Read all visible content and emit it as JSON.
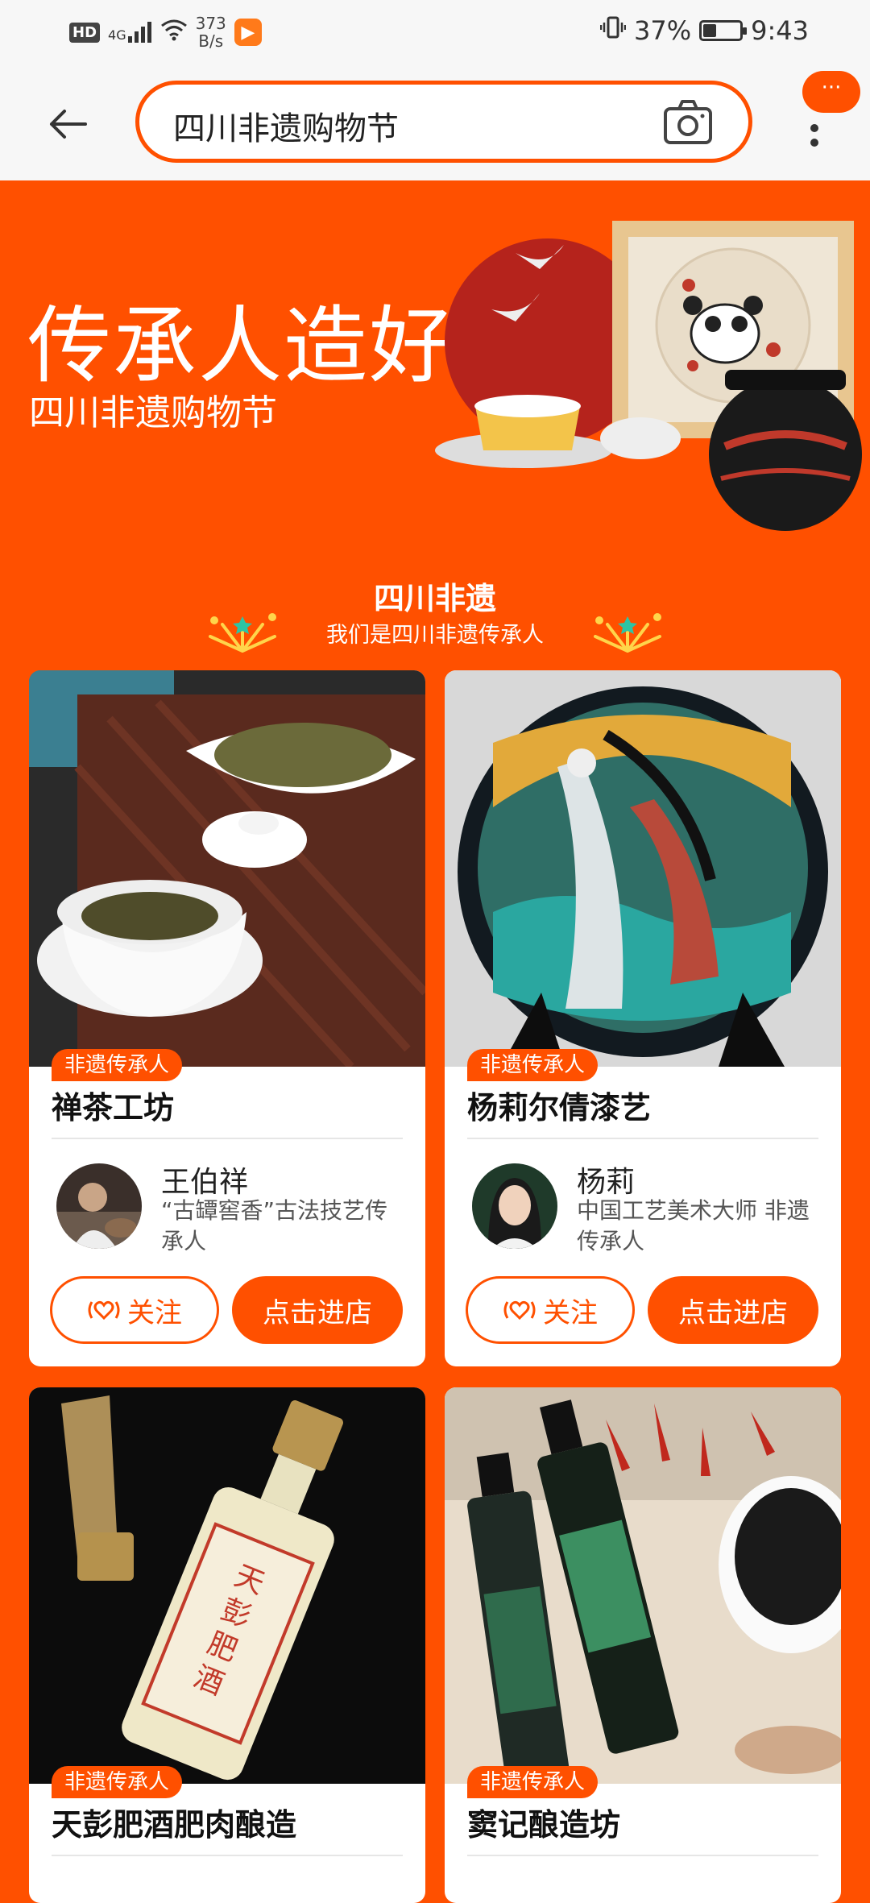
{
  "status_bar": {
    "hd": "HD",
    "network": "4G",
    "speed_value": "373",
    "speed_unit": "B/s",
    "battery_percent": "37%",
    "battery_level": 0.37,
    "time": "9:43"
  },
  "header": {
    "search_value": "四川非遗购物节",
    "more_label": "···"
  },
  "banner": {
    "title": "传承人造好物",
    "subtitle": "四川非遗购物节"
  },
  "section": {
    "title": "四川非遗",
    "subtitle": "我们是四川非遗传承人"
  },
  "cards": [
    {
      "tag": "非遗传承人",
      "shop_name": "禅茶工坊",
      "person_name": "王伯祥",
      "person_desc": "“古罈窖香”古法技艺传承人",
      "follow_label": "关注",
      "enter_label": "点击进店"
    },
    {
      "tag": "非遗传承人",
      "shop_name": "杨莉尔倩漆艺",
      "person_name": "杨莉",
      "person_desc": "中国工艺美术大师 非遗传承人",
      "follow_label": "关注",
      "enter_label": "点击进店"
    },
    {
      "tag": "非遗传承人",
      "shop_name": "天彭肥酒肥肉酿造"
    },
    {
      "tag": "非遗传承人",
      "shop_name": "窦记酿造坊"
    }
  ],
  "colors": {
    "brand": "#ff5000",
    "header_bg": "#f7f7f7"
  }
}
